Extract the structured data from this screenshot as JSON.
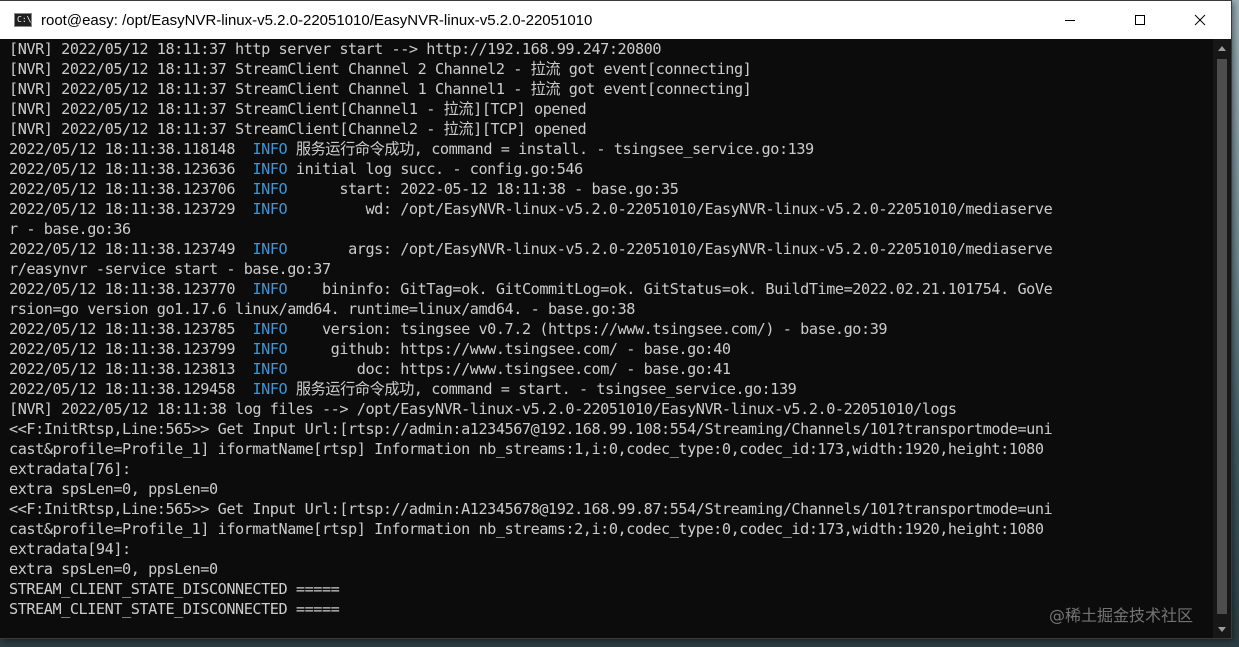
{
  "window": {
    "title": "root@easy: /opt/EasyNVR-linux-v5.2.0-22051010/EasyNVR-linux-v5.2.0-22051010",
    "icon_label": "C:\\_"
  },
  "controls": {
    "minimize_icon": "minimize-icon",
    "maximize_icon": "maximize-icon",
    "close_icon": "close-icon"
  },
  "terminal": {
    "lines": [
      {
        "text": "[NVR] 2022/05/12 18:11:37 http server start --> http://192.168.99.247:20800"
      },
      {
        "text": "[NVR] 2022/05/12 18:11:37 StreamClient Channel 2 Channel2 - 拉流 got event[connecting]"
      },
      {
        "text": "[NVR] 2022/05/12 18:11:37 StreamClient Channel 1 Channel1 - 拉流 got event[connecting]"
      },
      {
        "text": "[NVR] 2022/05/12 18:11:37 StreamClient[Channel1 - 拉流][TCP] opened"
      },
      {
        "text": "[NVR] 2022/05/12 18:11:37 StreamClient[Channel2 - 拉流][TCP] opened"
      },
      {
        "ts": "2022/05/12 18:11:38.118148",
        "level": "INFO",
        "text": " 服务运行命令成功, command = install. - tsingsee_service.go:139"
      },
      {
        "ts": "2022/05/12 18:11:38.123636",
        "level": "INFO",
        "text": " initial log succ. - config.go:546"
      },
      {
        "ts": "2022/05/12 18:11:38.123706",
        "level": "INFO",
        "text": "      start: 2022-05-12 18:11:38 - base.go:35"
      },
      {
        "ts": "2022/05/12 18:11:38.123729",
        "level": "INFO",
        "text": "         wd: /opt/EasyNVR-linux-v5.2.0-22051010/EasyNVR-linux-v5.2.0-22051010/mediaserve"
      },
      {
        "text": "r - base.go:36"
      },
      {
        "ts": "2022/05/12 18:11:38.123749",
        "level": "INFO",
        "text": "       args: /opt/EasyNVR-linux-v5.2.0-22051010/EasyNVR-linux-v5.2.0-22051010/mediaserve"
      },
      {
        "text": "r/easynvr -service start - base.go:37"
      },
      {
        "ts": "2022/05/12 18:11:38.123770",
        "level": "INFO",
        "text": "    bininfo: GitTag=ok. GitCommitLog=ok. GitStatus=ok. BuildTime=2022.02.21.101754. GoVe"
      },
      {
        "text": "rsion=go version go1.17.6 linux/amd64. runtime=linux/amd64. - base.go:38"
      },
      {
        "ts": "2022/05/12 18:11:38.123785",
        "level": "INFO",
        "text": "    version: tsingsee v0.7.2 (https://www.tsingsee.com/) - base.go:39"
      },
      {
        "ts": "2022/05/12 18:11:38.123799",
        "level": "INFO",
        "text": "     github: https://www.tsingsee.com/ - base.go:40"
      },
      {
        "ts": "2022/05/12 18:11:38.123813",
        "level": "INFO",
        "text": "        doc: https://www.tsingsee.com/ - base.go:41"
      },
      {
        "ts": "2022/05/12 18:11:38.129458",
        "level": "INFO",
        "text": " 服务运行命令成功, command = start. - tsingsee_service.go:139"
      },
      {
        "text": "[NVR] 2022/05/12 18:11:38 log files --> /opt/EasyNVR-linux-v5.2.0-22051010/EasyNVR-linux-v5.2.0-22051010/logs"
      },
      {
        "text": "<<F:InitRtsp,Line:565>> Get Input Url:[rtsp://admin:a1234567@192.168.99.108:554/Streaming/Channels/101?transportmode=uni"
      },
      {
        "text": "cast&profile=Profile_1] iformatName[rtsp] Information nb_streams:1,i:0,codec_type:0,codec_id:173,width:1920,height:1080"
      },
      {
        "text": "extradata[76]:"
      },
      {
        "text": "extra spsLen=0, ppsLen=0"
      },
      {
        "text": "<<F:InitRtsp,Line:565>> Get Input Url:[rtsp://admin:A12345678@192.168.99.87:554/Streaming/Channels/101?transportmode=uni"
      },
      {
        "text": "cast&profile=Profile_1] iformatName[rtsp] Information nb_streams:2,i:0,codec_type:0,codec_id:173,width:1920,height:1080"
      },
      {
        "text": "extradata[94]:"
      },
      {
        "text": "extra spsLen=0, ppsLen=0"
      },
      {
        "text": "STREAM_CLIENT_STATE_DISCONNECTED ====="
      },
      {
        "text": "STREAM_CLIENT_STATE_DISCONNECTED ====="
      }
    ]
  },
  "watermark": "@稀土掘金技术社区",
  "colors": {
    "terminal_bg": "#0c0c0c",
    "terminal_text": "#cccccc",
    "info_level": "#3a96dd",
    "titlebar_bg": "#ffffff"
  }
}
